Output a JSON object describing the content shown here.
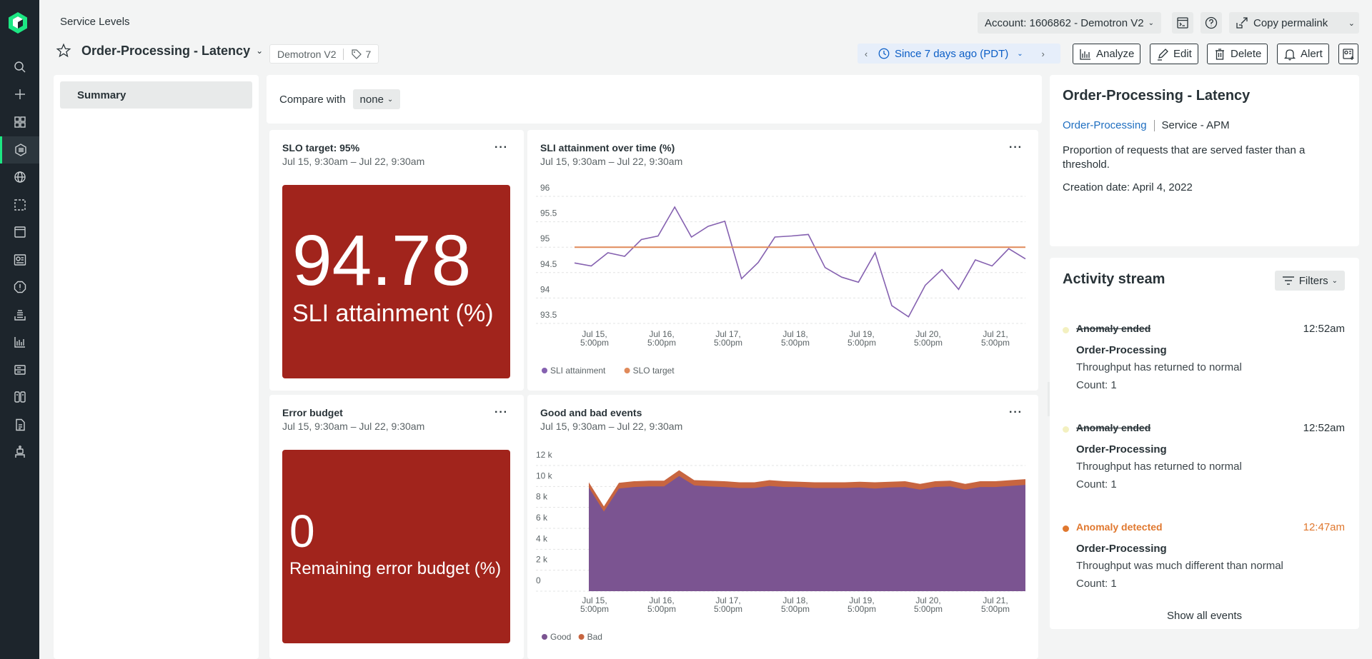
{
  "nav": {
    "items": [
      {
        "name": "search-icon"
      },
      {
        "name": "add-icon"
      },
      {
        "name": "apps-grid-icon"
      },
      {
        "name": "service-levels-icon",
        "active": true
      },
      {
        "name": "globe-icon"
      },
      {
        "name": "browser-select-icon"
      },
      {
        "name": "browser-window-icon"
      },
      {
        "name": "dashboards-icon"
      },
      {
        "name": "alerts-icon"
      },
      {
        "name": "logs-icon"
      },
      {
        "name": "query-chart-icon"
      },
      {
        "name": "infrastructure-icon"
      },
      {
        "name": "workloads-icon"
      },
      {
        "name": "document-icon"
      },
      {
        "name": "synthetics-robot-icon"
      }
    ]
  },
  "header": {
    "breadcrumb": "Service Levels",
    "title": "Order-Processing - Latency",
    "account_tag": "Demotron V2",
    "tag_count": "7",
    "account_selector": "Account: 1606862 - Demotron V2",
    "copy_permalink": "Copy permalink",
    "time_range": "Since 7 days ago (PDT)",
    "buttons": {
      "analyze": "Analyze",
      "edit": "Edit",
      "delete": "Delete",
      "alert": "Alert"
    }
  },
  "left_panel": {
    "items": [
      {
        "label": "Summary",
        "active": true
      }
    ]
  },
  "compare": {
    "label": "Compare with",
    "value": "none"
  },
  "cards": {
    "slo": {
      "title": "SLO target: 95%",
      "range": "Jul 15, 9:30am – Jul 22, 9:30am",
      "value": "94.78",
      "label": "SLI attainment (%)",
      "bg_color": "#a1241c"
    },
    "sli_chart": {
      "title": "SLI attainment over time (%)",
      "range": "Jul 15, 9:30am – Jul 22, 9:30am"
    },
    "error_budget": {
      "title": "Error budget",
      "range": "Jul 15, 9:30am – Jul 22, 9:30am",
      "value": "0",
      "label": "Remaining error budget (%)"
    },
    "events_chart": {
      "title": "Good and bad events",
      "range": "Jul 15, 9:30am – Jul 22, 9:30am"
    }
  },
  "chart_data": [
    {
      "type": "line",
      "title": "SLI attainment over time (%)",
      "x_tick_labels": [
        "Jul 15,\n5:00pm",
        "Jul 16,\n5:00pm",
        "Jul 17,\n5:00pm",
        "Jul 18,\n5:00pm",
        "Jul 19,\n5:00pm",
        "Jul 20,\n5:00pm",
        "Jul 21,\n5:00pm"
      ],
      "y_ticks": [
        "96",
        "95.5",
        "95",
        "94.5",
        "94",
        "93.5"
      ],
      "ylim": [
        93.4,
        96.0
      ],
      "grid": true,
      "legend_position": "bottom-left",
      "series": [
        {
          "name": "SLI attainment",
          "color": "#8561b0",
          "values": [
            94.69,
            94.63,
            94.89,
            94.82,
            95.15,
            95.22,
            95.79,
            95.2,
            95.41,
            95.51,
            94.38,
            94.7,
            95.2,
            95.22,
            95.25,
            94.6,
            94.41,
            94.31,
            94.89,
            93.85,
            93.63,
            94.25,
            94.56,
            94.17,
            94.75,
            94.63,
            94.97,
            94.77
          ]
        },
        {
          "name": "SLO target",
          "color": "#e08a5a",
          "values": [
            95,
            95,
            95,
            95,
            95,
            95,
            95,
            95,
            95,
            95,
            95,
            95,
            95,
            95,
            95,
            95,
            95,
            95,
            95,
            95,
            95,
            95,
            95,
            95,
            95,
            95,
            95,
            95
          ]
        }
      ]
    },
    {
      "type": "area",
      "title": "Good and bad events",
      "stacked": true,
      "x_tick_labels": [
        "Jul 15,\n5:00pm",
        "Jul 16,\n5:00pm",
        "Jul 17,\n5:00pm",
        "Jul 18,\n5:00pm",
        "Jul 19,\n5:00pm",
        "Jul 20,\n5:00pm",
        "Jul 21,\n5:00pm"
      ],
      "y_ticks": [
        "12 k",
        "10 k",
        "8 k",
        "6 k",
        "4 k",
        "2 k",
        "0"
      ],
      "ylim": [
        0,
        12000
      ],
      "grid": true,
      "legend_position": "bottom-left",
      "series": [
        {
          "name": "Good",
          "color": "#7b5491",
          "values": [
            9900,
            7600,
            9800,
            9950,
            10000,
            10000,
            11000,
            10100,
            10000,
            9950,
            9850,
            9850,
            10050,
            9950,
            9950,
            9850,
            9850,
            9850,
            9900,
            9800,
            9900,
            9950,
            9700,
            9950,
            10000,
            9700,
            9950,
            9950,
            10050,
            10150
          ]
        },
        {
          "name": "Bad",
          "color": "#c76540",
          "values": [
            500,
            500,
            550,
            550,
            550,
            550,
            550,
            500,
            550,
            550,
            550,
            550,
            550,
            550,
            500,
            550,
            550,
            550,
            550,
            600,
            550,
            550,
            550,
            550,
            550,
            550,
            550,
            550,
            550,
            550
          ]
        }
      ]
    }
  ],
  "details": {
    "title": "Order-Processing - Latency",
    "entity_link": "Order-Processing",
    "entity_type": "Service - APM",
    "description": "Proportion of requests that are served faster than a threshold.",
    "creation_date": "Creation date: April 4, 2022"
  },
  "activity": {
    "title": "Activity stream",
    "filters_label": "Filters",
    "events": [
      {
        "type": "Anomaly ended",
        "time": "12:52am",
        "entity": "Order-Processing",
        "desc": "Throughput has returned to normal",
        "count": "Count: 1",
        "color": "#293338",
        "dot": "#f3f0c0",
        "struck": true
      },
      {
        "type": "Anomaly ended",
        "time": "12:52am",
        "entity": "Order-Processing",
        "desc": "Throughput has returned to normal",
        "count": "Count: 1",
        "color": "#293338",
        "dot": "#f3f0c0",
        "struck": true
      },
      {
        "type": "Anomaly detected",
        "time": "12:47am",
        "entity": "Order-Processing",
        "desc": "Throughput was much different than normal",
        "count": "Count: 1",
        "color": "#e0782f",
        "dot": "#e0782f",
        "struck": false
      }
    ],
    "show_all": "Show all events"
  }
}
